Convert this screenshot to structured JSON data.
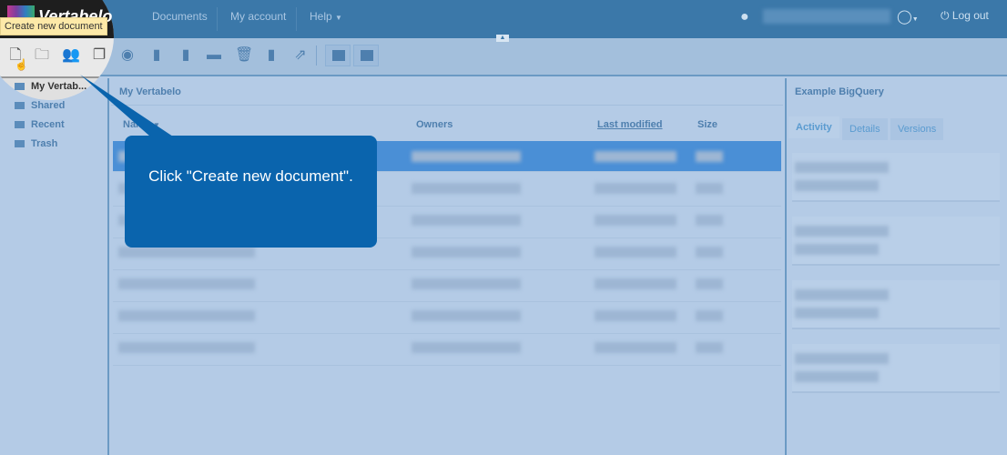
{
  "header": {
    "logo": "Vertabelo",
    "nav": [
      "Documents",
      "My account",
      "Help"
    ],
    "logout": "Log out",
    "icons": [
      "user-icon",
      "chat-icon",
      "power-icon"
    ]
  },
  "toolbar": {
    "tooltip": "Create new document",
    "icons": [
      "new-document-icon",
      "new-folder-icon",
      "share-icon",
      "copy-icon",
      "view-icon",
      "download-icon",
      "edit-icon",
      "move-icon",
      "trash-icon",
      "upload-icon",
      "export-icon",
      "layout-left-icon",
      "layout-right-icon"
    ]
  },
  "sidebar": {
    "items": [
      "My Vertab...",
      "Shared",
      "Recent",
      "Trash"
    ]
  },
  "main": {
    "title": "My Vertabelo",
    "columns": [
      "Name",
      "Owners",
      "Last modified",
      "Size"
    ]
  },
  "right": {
    "title": "Example BigQuery",
    "tabs": [
      "Activity",
      "Details",
      "Versions"
    ]
  },
  "callout": {
    "text": "Click \"Create new document\"."
  },
  "colors": {
    "header": "#3b78a9",
    "callout": "#0a64ad",
    "selected": "#4a8fd6"
  }
}
